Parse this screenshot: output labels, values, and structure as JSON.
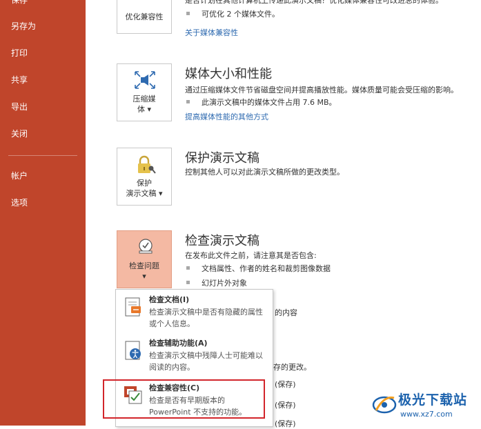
{
  "sidebar": {
    "items": [
      {
        "label": "保存"
      },
      {
        "label": "另存为"
      },
      {
        "label": "打印"
      },
      {
        "label": "共享"
      },
      {
        "label": "导出"
      },
      {
        "label": "关闭"
      },
      {
        "label": "帐户"
      },
      {
        "label": "选项"
      }
    ],
    "bg_color": "#c0452b"
  },
  "sections": {
    "compat": {
      "button_label": "优化兼容性",
      "desc_partial": "是否计划在其他计算机上传递此演示文稿？优化媒体兼容性可改进总的体验。",
      "bullet": "可优化 2 个媒体文件。",
      "link": "关于媒体兼容性"
    },
    "media": {
      "title": "媒体大小和性能",
      "button_label_1": "压缩媒",
      "button_label_2": "体 ▾",
      "desc": "通过压缩媒体文件节省磁盘空间并提高播放性能。媒体质量可能会受压缩的影响。",
      "bullet": "此演示文稿中的媒体文件占用 7.6 MB。",
      "link": "提高媒体性能的其他方式"
    },
    "protect": {
      "title": "保护演示文稿",
      "button_label_1": "保护",
      "button_label_2": "演示文稿 ▾",
      "desc": "控制其他人可以对此演示文稿所做的更改类型。"
    },
    "inspect": {
      "title": "检查演示文稿",
      "button_label_1": "检查问题",
      "button_label_2": "▾",
      "desc": "在发布此文件之前，请注意其是否包含:",
      "bullets": [
        "文档属性、作者的姓名和裁剪图像数据",
        "幻灯片外对象"
      ],
      "partial_texts": [
        "的内容",
        "存的更改。",
        "(保存)",
        "(保存)",
        "(保存)"
      ]
    }
  },
  "dropdown": {
    "items": [
      {
        "title": "检查文档(I)",
        "desc": "检查演示文稿中是否有隐藏的属性或个人信息。"
      },
      {
        "title": "检查辅助功能(A)",
        "desc": "检查演示文稿中残障人士可能难以阅读的内容。"
      },
      {
        "title": "检查兼容性(C)",
        "desc": "检查是否有早期版本的 PowerPoint 不支持的功能。"
      }
    ]
  },
  "watermark": {
    "text": "极光下载站",
    "url": "www.xz7.com"
  }
}
